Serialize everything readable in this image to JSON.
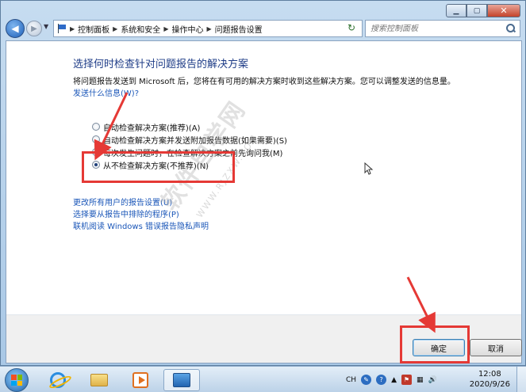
{
  "navbar": {
    "breadcrumb": [
      "控制面板",
      "系统和安全",
      "操作中心",
      "问题报告设置"
    ],
    "search_placeholder": "搜索控制面板"
  },
  "content": {
    "title": "选择何时检查针对问题报告的解决方案",
    "description": "将问题报告发送到 Microsoft 后，您将在有可用的解决方案时收到这些解决方案。您可以调整发送的信息量。",
    "what_sent_link": "发送什么信息(W)?",
    "options": [
      {
        "label": "自动检查解决方案(推荐)(A)",
        "checked": false
      },
      {
        "label": "自动检查解决方案并发送附加报告数据(如果需要)(S)",
        "checked": false
      },
      {
        "label": "每次发生问题时，在检查解决方案之前先询问我(M)",
        "checked": false
      },
      {
        "label": "从不检查解决方案(不推荐)(N)",
        "checked": true
      }
    ],
    "links": [
      "更改所有用户的报告设置(U)",
      "选择要从报告中排除的程序(P)",
      "联机阅读 Windows 错误报告隐私声明"
    ]
  },
  "footer": {
    "ok_label": "确定",
    "cancel_label": "取消"
  },
  "watermark": {
    "main": "软件自学网",
    "sub": "WWW.RJZXW.COM"
  },
  "taskbar": {
    "language": "CH",
    "time": "12:08",
    "date": "2020/9/26"
  },
  "colors": {
    "title": "#1e3c87",
    "link": "#1a56b8",
    "annotation": "#e53935"
  }
}
